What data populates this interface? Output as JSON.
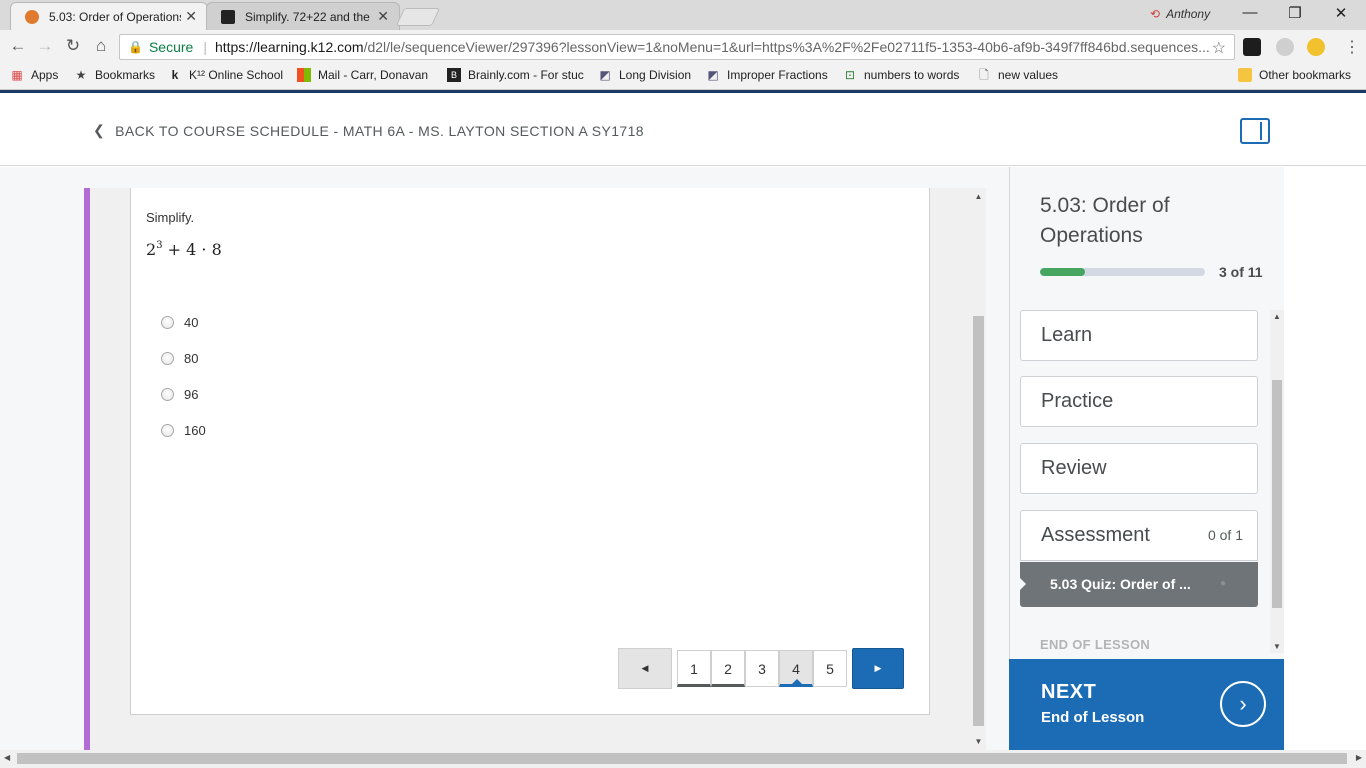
{
  "browser": {
    "tabs": [
      {
        "title": "5.03: Order of Operations",
        "close": "✕"
      },
      {
        "title": "Simplify. 72+22 and the",
        "close": "✕"
      }
    ],
    "user": "Anthony",
    "window_controls": {
      "minimize": "—",
      "maximize": "❐",
      "close": "✕"
    },
    "address": {
      "secure_label": "Secure",
      "host": "https://learning.k12.com",
      "path": "/d2l/le/sequenceViewer/297396?lessonView=1&noMenu=1&url=https%3A%2F%2Fe02711f5-1353-40b6-af9b-349f7ff846bd.sequences..."
    },
    "bookmarks": [
      {
        "label": "Apps",
        "icon": "apps-grid-icon"
      },
      {
        "label": "Bookmarks",
        "icon": "star-icon"
      },
      {
        "label": "K¹² Online School",
        "icon": "k12-icon"
      },
      {
        "label": "Mail - Carr, Donavan",
        "icon": "microsoft-icon"
      },
      {
        "label": "Brainly.com - For stuc",
        "icon": "brainly-icon"
      },
      {
        "label": "Long Division",
        "icon": "page-icon"
      },
      {
        "label": "Improper Fractions",
        "icon": "page-icon"
      },
      {
        "label": "numbers to words",
        "icon": "green-icon"
      },
      {
        "label": "new values",
        "icon": "document-icon"
      }
    ],
    "other_bookmarks": "Other bookmarks"
  },
  "header": {
    "back_link": "BACK TO COURSE SCHEDULE - MATH 6A - MS. LAYTON SECTION A SY1718"
  },
  "question": {
    "prompt": "Simplify.",
    "expression": {
      "base": "2",
      "exponent": "3",
      "rest": "+ 4 · 8"
    },
    "options": [
      "40",
      "80",
      "96",
      "160"
    ]
  },
  "pager": {
    "prev": "◀",
    "pages": [
      "1",
      "2",
      "3",
      "4",
      "5"
    ],
    "current_page": "4",
    "next": "▶"
  },
  "sidebar": {
    "lesson_title": "5.03: Order of Operations",
    "progress_text": "3 of 11",
    "progress_fraction": 0.27,
    "items": [
      {
        "label": "Learn"
      },
      {
        "label": "Practice"
      },
      {
        "label": "Review"
      },
      {
        "label": "Assessment",
        "count": "0 of 1"
      }
    ],
    "quiz_item": "5.03 Quiz: Order of ...",
    "end_of_lesson": "END OF LESSON"
  },
  "next_panel": {
    "label": "NEXT",
    "sub": "End of Lesson"
  },
  "colors": {
    "accent_blue": "#1b6bb5",
    "progress_green": "#46a661",
    "lesson_purple": "#b36bd6"
  }
}
